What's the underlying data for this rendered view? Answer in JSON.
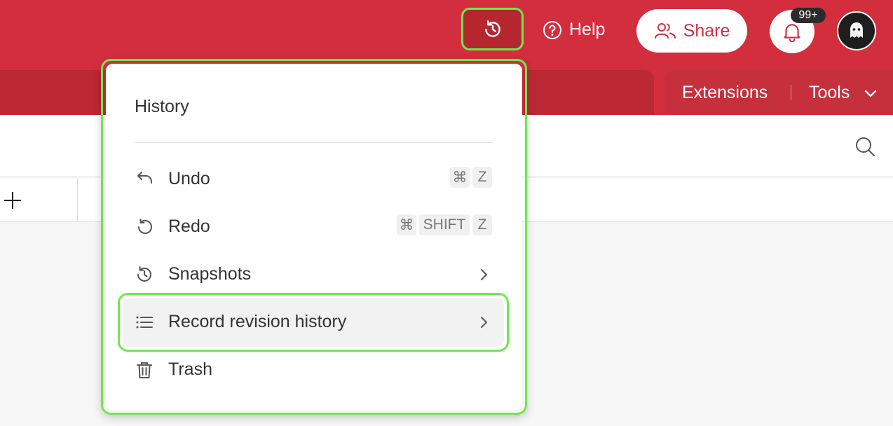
{
  "header": {
    "help_label": "Help",
    "share_label": "Share",
    "notification_badge": "99+"
  },
  "subbar": {
    "extensions_label": "Extensions",
    "tools_label": "Tools"
  },
  "history_menu": {
    "title": "History",
    "items": [
      {
        "label": "Undo",
        "icon": "undo-icon",
        "shortcut": [
          "⌘",
          "Z"
        ]
      },
      {
        "label": "Redo",
        "icon": "redo-icon",
        "shortcut": [
          "⌘",
          "SHIFT",
          "Z"
        ]
      },
      {
        "label": "Snapshots",
        "icon": "history-icon",
        "submenu": true
      },
      {
        "label": "Record revision history",
        "icon": "list-icon",
        "submenu": true,
        "highlighted": true
      },
      {
        "label": "Trash",
        "icon": "trash-icon"
      }
    ]
  },
  "colors": {
    "brand_red": "#d22e3e",
    "highlight_green": "#6cea4c"
  }
}
